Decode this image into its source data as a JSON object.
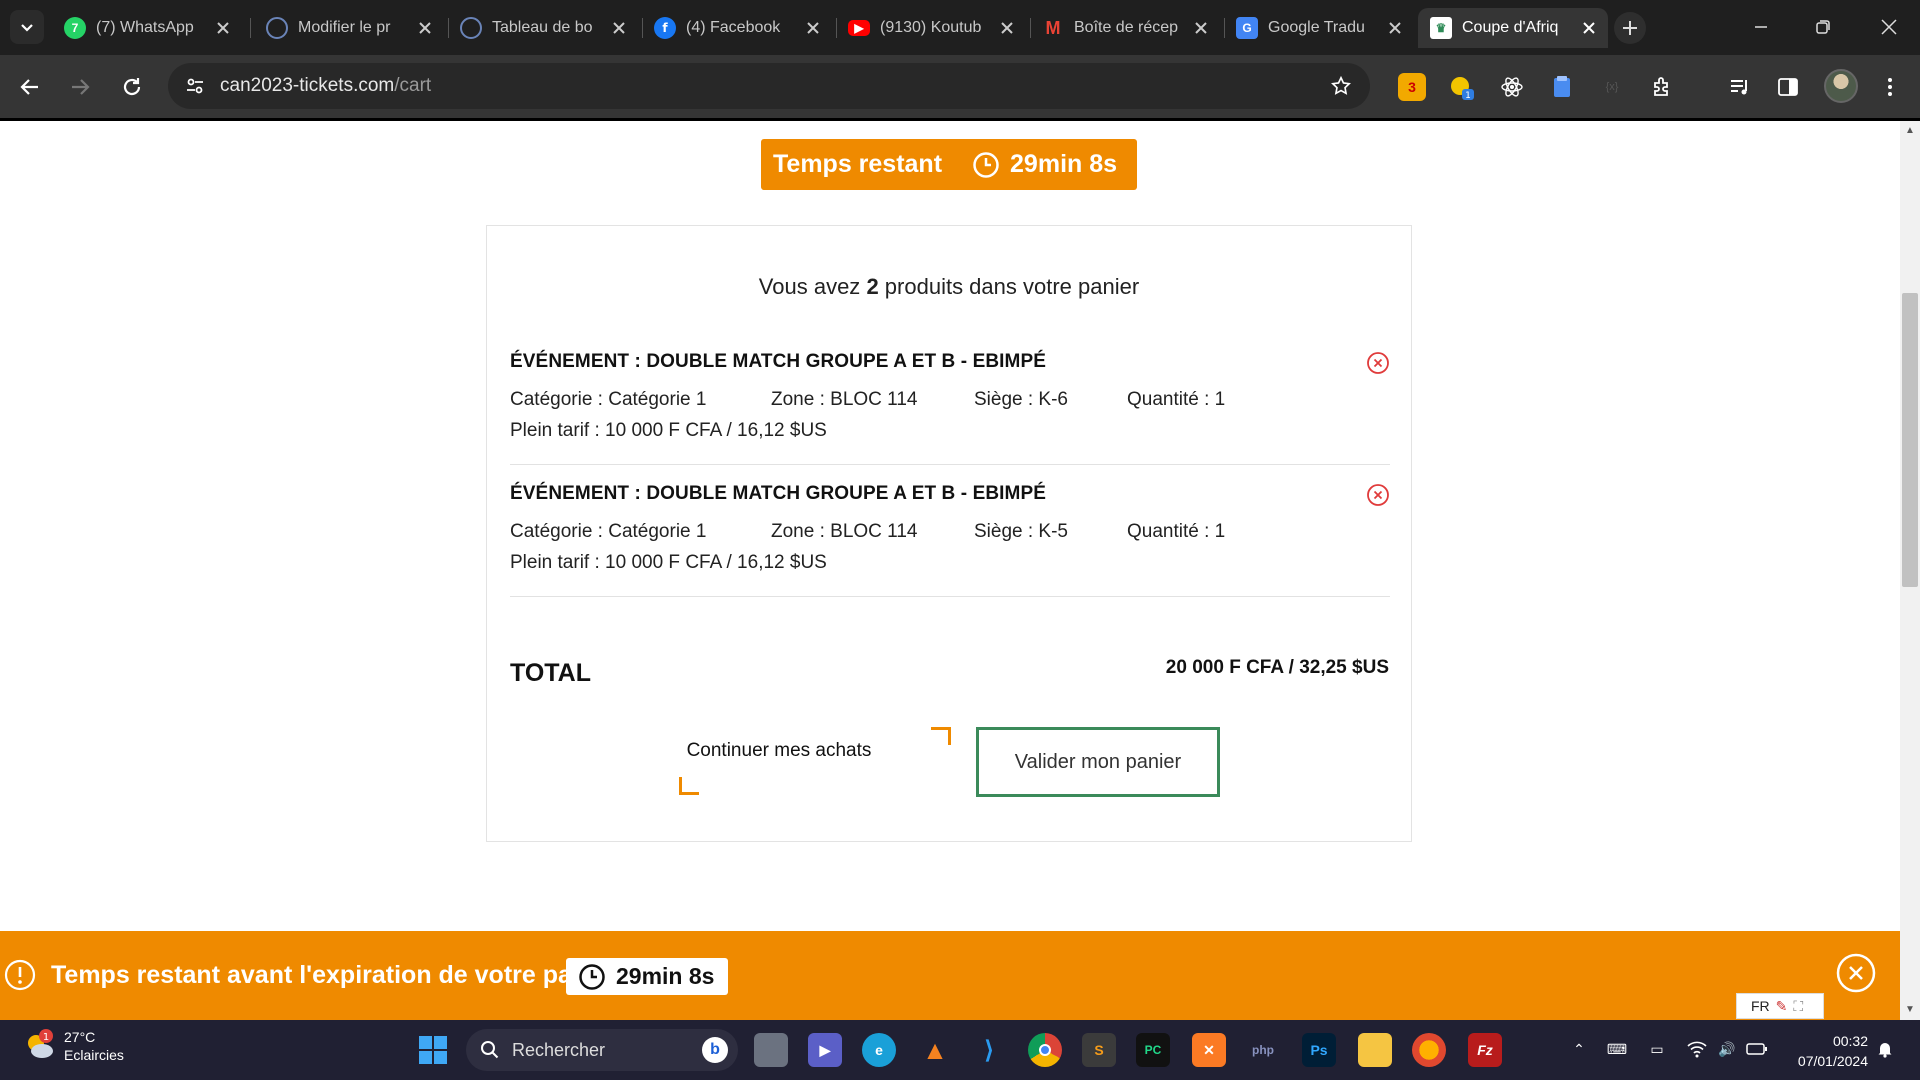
{
  "browser": {
    "tabs": [
      {
        "title": "(7) WhatsApp",
        "icon": "whatsapp-icon",
        "color": "#25d366"
      },
      {
        "title": "Modifier le pr",
        "icon": "globe-icon",
        "color": "#3a5a8c"
      },
      {
        "title": "Tableau de bo",
        "icon": "globe-icon",
        "color": "#3a5a8c"
      },
      {
        "title": "(4) Facebook",
        "icon": "facebook-icon",
        "color": "#1877f2"
      },
      {
        "title": "(9130) Koutub",
        "icon": "youtube-icon",
        "color": "#ff0000"
      },
      {
        "title": "Boîte de récep",
        "icon": "gmail-icon",
        "color": "#ea4335"
      },
      {
        "title": "Google Tradu",
        "icon": "google-translate-icon",
        "color": "#4285f4"
      },
      {
        "title": "Coupe d'Afriq",
        "icon": "can-trophy-icon",
        "color": "#2e8b57"
      }
    ],
    "url_host": "can2023-tickets.com",
    "url_path": "/cart"
  },
  "timer": {
    "label": "Temps restant",
    "value": "29min 8s"
  },
  "cart": {
    "summary_prefix": "Vous avez ",
    "count": "2",
    "summary_suffix": " produits dans votre panier",
    "items": [
      {
        "event": "ÉVÉNEMENT : DOUBLE MATCH GROUPE A ET B - EBIMPÉ",
        "category": "Catégorie : Catégorie 1",
        "zone": "Zone : BLOC 114",
        "seat": "Siège : K-6",
        "quantity": "Quantité : 1",
        "price": "Plein tarif : 10 000 F CFA / 16,12 $US"
      },
      {
        "event": "ÉVÉNEMENT : DOUBLE MATCH GROUPE A ET B - EBIMPÉ",
        "category": "Catégorie : Catégorie 1",
        "zone": "Zone : BLOC 114",
        "seat": "Siège : K-5",
        "quantity": "Quantité : 1",
        "price": "Plein tarif : 10 000 F CFA / 16,12 $US"
      }
    ],
    "total_label": "TOTAL",
    "total_value": "20 000 F CFA / 32,25 $US",
    "continue_label": "Continuer mes achats",
    "validate_label": "Valider mon panier"
  },
  "expire_bar": {
    "text": "Temps restant avant l'expiration de votre panier",
    "value": "29min 8s",
    "lang": "FR"
  },
  "taskbar": {
    "temperature": "27°C",
    "weather": "Eclaircies",
    "weather_badge": "1",
    "search_placeholder": "Rechercher",
    "time": "00:32",
    "date": "07/01/2024"
  },
  "colors": {
    "accent": "#ef8a00",
    "validate_border": "#3b8a5a",
    "remove_icon": "#e03b3b"
  }
}
